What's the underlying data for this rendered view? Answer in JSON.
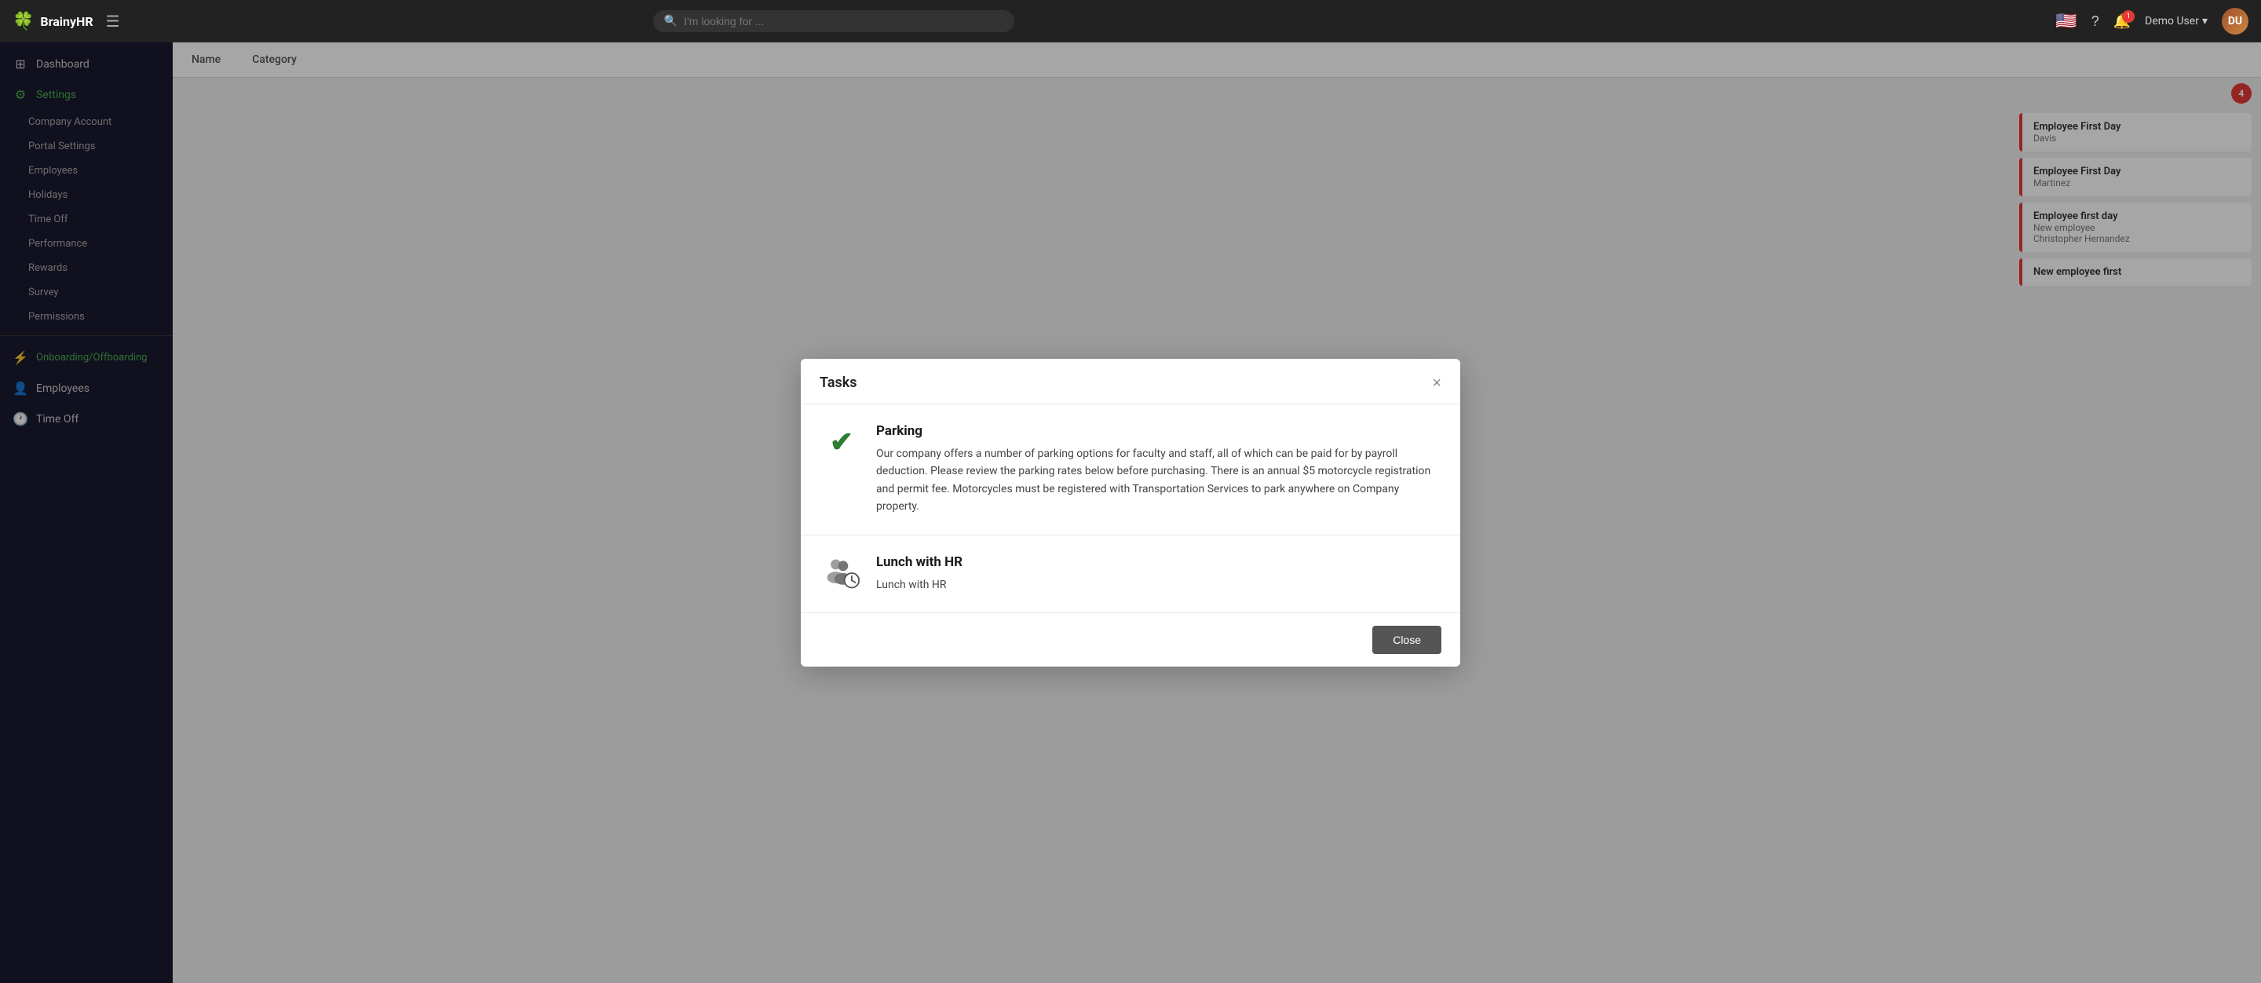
{
  "app": {
    "name": "BrainyHR",
    "logo_icon": "🍀"
  },
  "topnav": {
    "search_placeholder": "I'm looking for ...",
    "user_label": "Demo User",
    "bell_badge": "1",
    "flag": "🇺🇸"
  },
  "sidebar": {
    "items": [
      {
        "id": "dashboard",
        "label": "Dashboard",
        "icon": "⊞"
      },
      {
        "id": "settings",
        "label": "Settings",
        "icon": "⚙",
        "active": true
      }
    ],
    "subitems": [
      {
        "id": "company-account",
        "label": "Company Account"
      },
      {
        "id": "portal-settings",
        "label": "Portal Settings"
      },
      {
        "id": "employees",
        "label": "Employees"
      },
      {
        "id": "holidays",
        "label": "Holidays"
      },
      {
        "id": "time-off",
        "label": "Time Off"
      },
      {
        "id": "performance",
        "label": "Performance"
      },
      {
        "id": "rewards",
        "label": "Rewards"
      },
      {
        "id": "survey",
        "label": "Survey"
      },
      {
        "id": "permissions",
        "label": "Permissions"
      }
    ],
    "bottom_items": [
      {
        "id": "onboarding",
        "label": "Onboarding/Offboarding",
        "icon": "⚡",
        "active": true
      },
      {
        "id": "employees-bottom",
        "label": "Employees",
        "icon": "👤"
      },
      {
        "id": "time-off-bottom",
        "label": "Time Off",
        "icon": "🕐"
      }
    ]
  },
  "table": {
    "headers": [
      "Name",
      "Category"
    ]
  },
  "right_panel": {
    "badge": "4",
    "items": [
      {
        "title": "Employee First Day",
        "subtitle": "Davis",
        "border_color": "#e53935"
      },
      {
        "title": "Employee First Day",
        "subtitle": "Martinez",
        "border_color": "#e53935"
      },
      {
        "title": "Employee first day",
        "detail": "New employee",
        "subtitle": "Christopher Hernandez",
        "border_color": "#e53935"
      },
      {
        "title": "New employee first",
        "border_color": "#e53935"
      }
    ]
  },
  "modal": {
    "title": "Tasks",
    "close_label": "×",
    "tasks": [
      {
        "id": "parking",
        "icon_type": "check",
        "title": "Parking",
        "description": "Our company offers a number of parking options for faculty and staff, all of which can be paid for by payroll deduction. Please review the parking rates below before purchasing. There is an annual $5 motorcycle registration and permit fee. Motorcycles must be registered with Transportation Services to park anywhere on Company property."
      },
      {
        "id": "lunch-with-hr",
        "icon_type": "people",
        "title": "Lunch with HR",
        "description": "Lunch with HR"
      }
    ],
    "footer": {
      "close_button_label": "Close"
    }
  }
}
